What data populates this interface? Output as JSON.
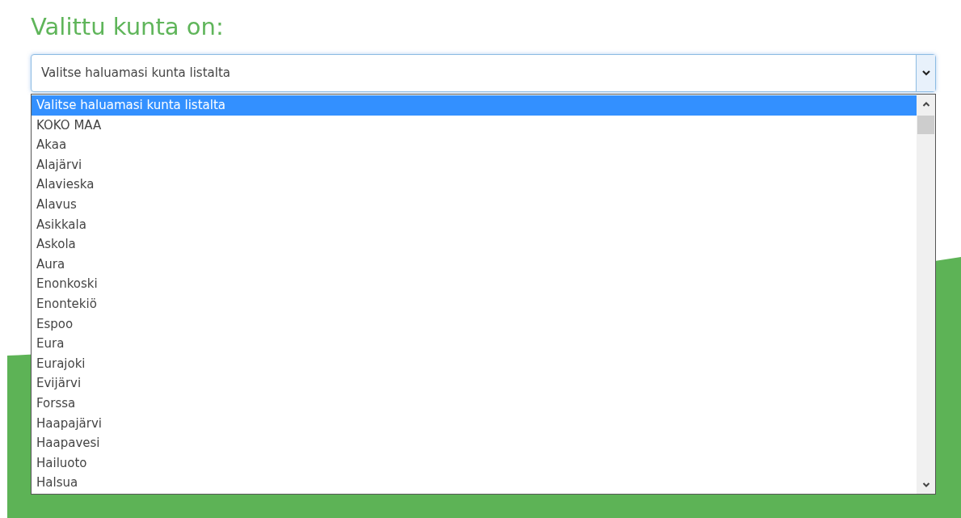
{
  "heading": "Valittu kunta on:",
  "select": {
    "value": "Valitse haluamasi kunta listalta",
    "expanded": true
  },
  "options": [
    {
      "label": "Valitse haluamasi kunta listalta",
      "selected": true
    },
    {
      "label": "KOKO MAA",
      "selected": false
    },
    {
      "label": "Akaa",
      "selected": false
    },
    {
      "label": "Alajärvi",
      "selected": false
    },
    {
      "label": "Alavieska",
      "selected": false
    },
    {
      "label": "Alavus",
      "selected": false
    },
    {
      "label": "Asikkala",
      "selected": false
    },
    {
      "label": "Askola",
      "selected": false
    },
    {
      "label": "Aura",
      "selected": false
    },
    {
      "label": "Enonkoski",
      "selected": false
    },
    {
      "label": "Enontekiö",
      "selected": false
    },
    {
      "label": "Espoo",
      "selected": false
    },
    {
      "label": "Eura",
      "selected": false
    },
    {
      "label": "Eurajoki",
      "selected": false
    },
    {
      "label": "Evijärvi",
      "selected": false
    },
    {
      "label": "Forssa",
      "selected": false
    },
    {
      "label": "Haapajärvi",
      "selected": false
    },
    {
      "label": "Haapavesi",
      "selected": false
    },
    {
      "label": "Hailuoto",
      "selected": false
    },
    {
      "label": "Halsua",
      "selected": false
    }
  ]
}
